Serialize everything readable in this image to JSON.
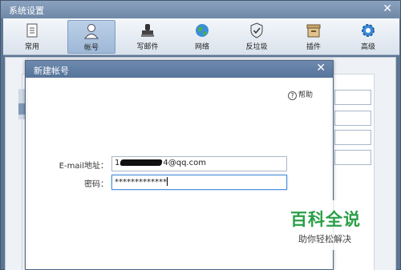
{
  "window": {
    "title": "系统设置"
  },
  "toolbar": {
    "items": [
      {
        "label": "常用",
        "icon": "document-icon"
      },
      {
        "label": "帐号",
        "icon": "user-icon",
        "active": true
      },
      {
        "label": "写邮件",
        "icon": "stamp-icon"
      },
      {
        "label": "网络",
        "icon": "globe-icon"
      },
      {
        "label": "反垃圾",
        "icon": "shield-icon"
      },
      {
        "label": "插件",
        "icon": "box-icon"
      },
      {
        "label": "高级",
        "icon": "gear-icon"
      }
    ]
  },
  "dialog": {
    "title": "新建帐号",
    "help_label": "帮助",
    "email": {
      "label": "E-mail地址：",
      "value_prefix": "1",
      "value_suffix": "4@qq.com"
    },
    "password": {
      "label": "密码：",
      "value": "*************"
    }
  },
  "watermark": {
    "brand": "百科全说",
    "slogan": "助你轻松解决"
  },
  "colors": {
    "active_tab": "#9db8d7",
    "title_bar": "#56739a",
    "watermark_green": "#2aa048"
  }
}
